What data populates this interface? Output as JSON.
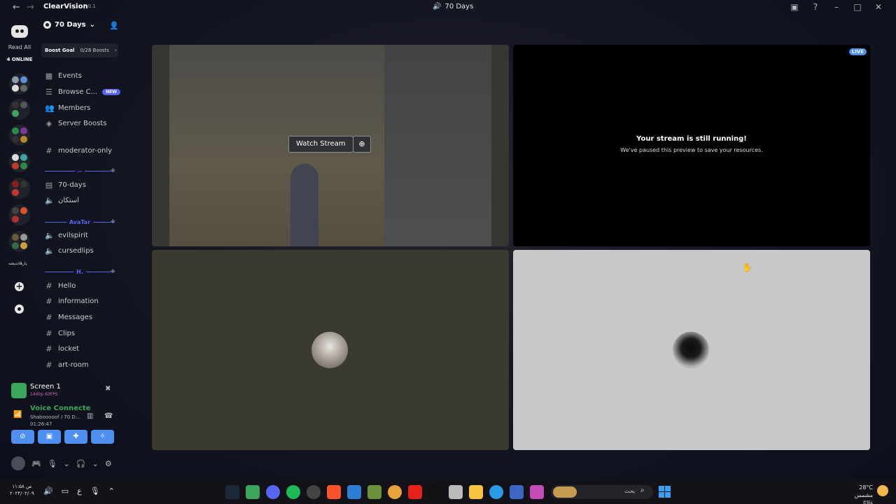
{
  "titlebar": {
    "app_name": "ClearVision",
    "app_version": "7.0.1",
    "window_title": "70 Days"
  },
  "rail": {
    "read_all": "Read All",
    "online_count": "4 ONLINE",
    "text_server": "پارهٔاندیشه"
  },
  "server": {
    "name": "70 Days",
    "boost_goal_label": "Boost Goal",
    "boost_count": "0/28 Boosts"
  },
  "sidebar": {
    "top_items": [
      {
        "label": "Events",
        "icon": "calendar-icon"
      },
      {
        "label": "Browse C...",
        "icon": "browse-icon",
        "badge": "NEW"
      },
      {
        "label": "Members",
        "icon": "members-icon"
      },
      {
        "label": "Server Boosts",
        "icon": "boost-icon"
      }
    ],
    "moderator_channel": "moderator-only",
    "category_1": "--",
    "voice_section": [
      {
        "label": "70-days",
        "icon": "stage-icon"
      },
      {
        "label": "استکان",
        "icon": "speaker-icon"
      }
    ],
    "category_2": "AvaTar",
    "avatar_section": [
      {
        "label": "evilspirit",
        "icon": "speaker-icon"
      },
      {
        "label": "cursedlips",
        "icon": "speaker-icon"
      }
    ],
    "category_3": "H.",
    "text_channels": [
      "Hello",
      "information",
      "Messages",
      "Clips",
      "locket",
      "art-room"
    ]
  },
  "screen_share": {
    "title": "Screen 1",
    "quality": "1440p 60FPS"
  },
  "voice": {
    "status": "Voice Connecte",
    "channel": "Shabooooof / 70 D...",
    "timer": "01:26:47"
  },
  "stage": {
    "watch_stream": "Watch Stream",
    "live_badge": "LIVE",
    "paused_title": "Your stream is still running!",
    "paused_subtitle": "We've paused this preview to save your resources."
  },
  "taskbar": {
    "time": "۱۱:۵۸ ص",
    "date": "۲۰۲۴/۰۲/۰۹",
    "lang": "ع",
    "search_placeholder": "بحث",
    "temperature": "28°C",
    "weather_text": "مشمس غالبًا"
  },
  "colors": {
    "accent": "#5865f2",
    "voice_connected": "#3ba55c",
    "button_blue": "#4e8ff0",
    "quality_pink": "#d06ab5"
  }
}
